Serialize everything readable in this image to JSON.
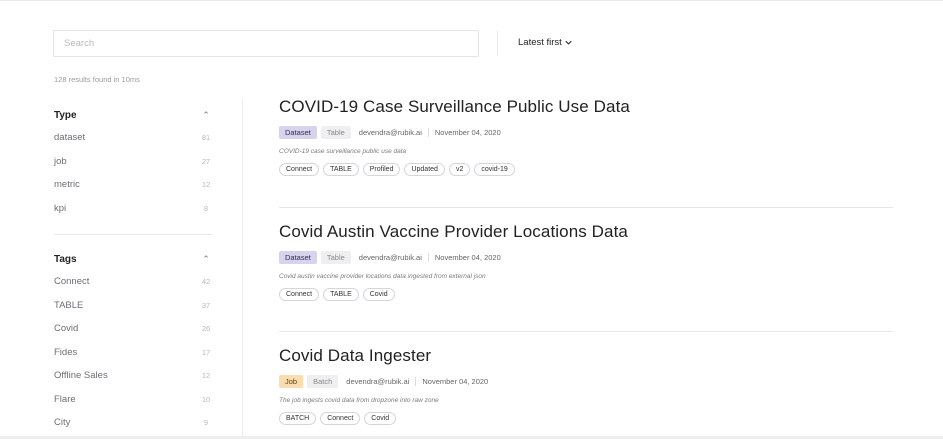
{
  "search": {
    "placeholder": "Search",
    "value": ""
  },
  "sort": {
    "label": "Latest first"
  },
  "results_text": "128 results found in 10ms",
  "facets": {
    "type": {
      "title": "Type",
      "items": [
        {
          "label": "dataset",
          "count": "81"
        },
        {
          "label": "job",
          "count": "27"
        },
        {
          "label": "metric",
          "count": "12"
        },
        {
          "label": "kpi",
          "count": "8"
        }
      ]
    },
    "tags": {
      "title": "Tags",
      "items": [
        {
          "label": "Connect",
          "count": "42"
        },
        {
          "label": "TABLE",
          "count": "37"
        },
        {
          "label": "Covid",
          "count": "26"
        },
        {
          "label": "Fides",
          "count": "17"
        },
        {
          "label": "Offline Sales",
          "count": "12"
        },
        {
          "label": "Flare",
          "count": "10"
        },
        {
          "label": "City",
          "count": "9"
        }
      ]
    }
  },
  "results": [
    {
      "title": "COVID-19 Case Surveillance Public Use Data",
      "type": "Dataset",
      "subtype": "Table",
      "author": "devendra@rubik.ai",
      "date": "November 04, 2020",
      "description": "COVID-19 case surveillance public use data",
      "tags": [
        "Connect",
        "TABLE",
        "Profiled",
        "Updated",
        "v2",
        "covid-19"
      ]
    },
    {
      "title": "Covid Austin Vaccine Provider Locations Data",
      "type": "Dataset",
      "subtype": "Table",
      "author": "devendra@rubik.ai",
      "date": "November 04, 2020",
      "description": "Covid austin vaccine provider locations data ingested from external json",
      "tags": [
        "Connect",
        "TABLE",
        "Covid"
      ]
    },
    {
      "title": "Covid Data Ingester",
      "type": "Job",
      "subtype": "Batch",
      "author": "devendra@rubik.ai",
      "date": "November 04, 2020",
      "description": "The job ingests covid data from dropzone into raw zone",
      "tags": [
        "BATCH",
        "Connect",
        "Covid"
      ]
    }
  ],
  "icons": {
    "sort_chevron": "chevron-down-icon",
    "collapse": "chevron-up-icon"
  }
}
